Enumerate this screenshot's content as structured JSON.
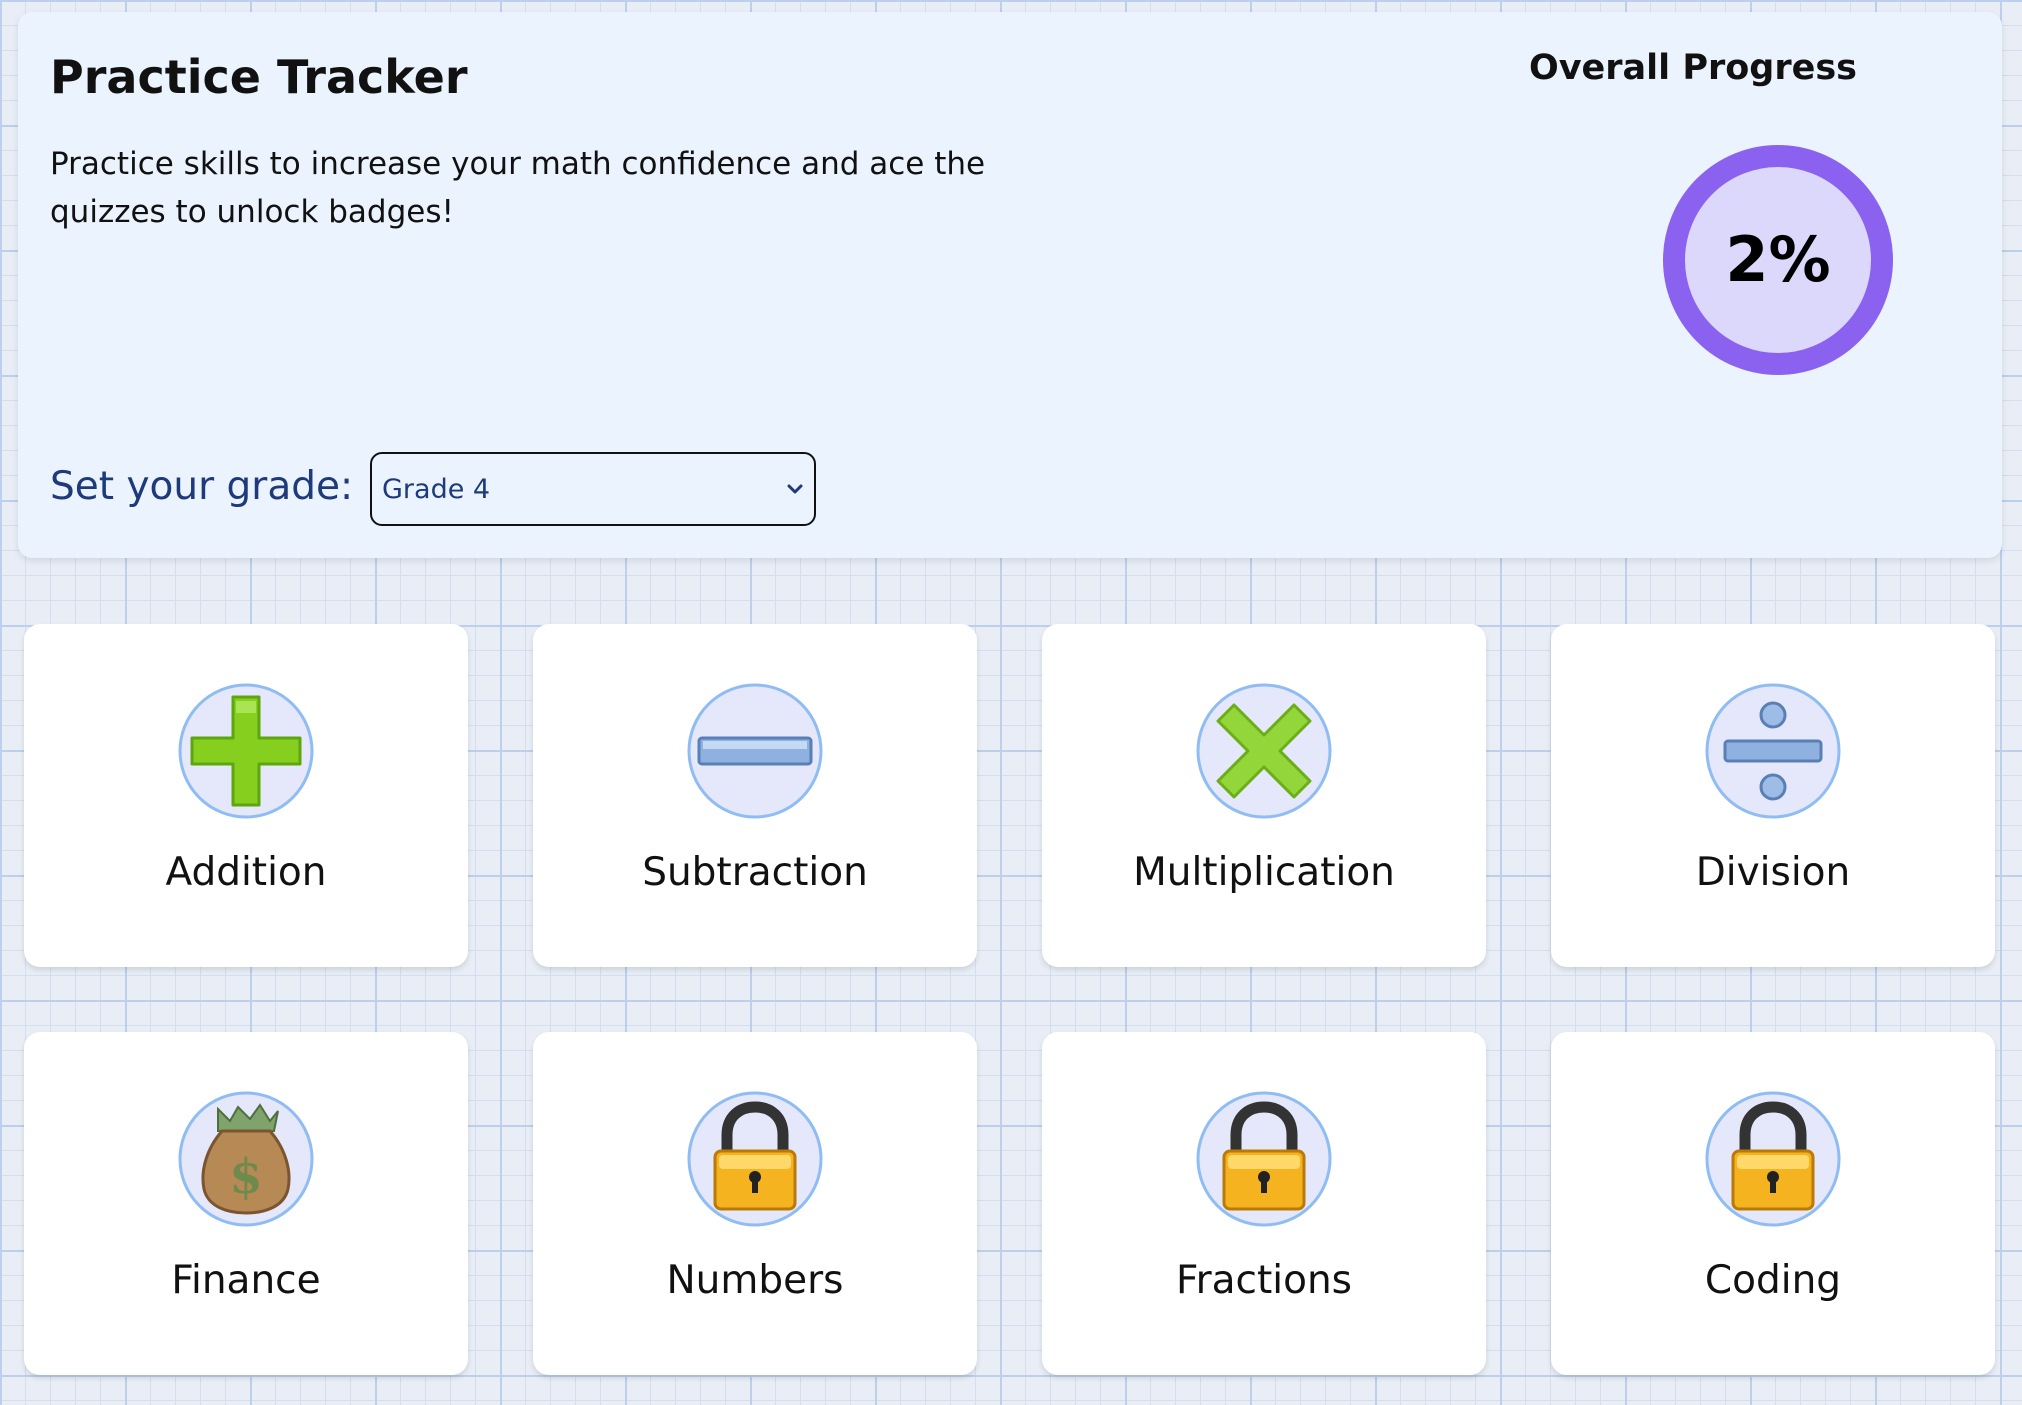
{
  "header": {
    "title": "Practice Tracker",
    "intro": "Practice skills to increase your math confidence and ace the quizzes to unlock badges!",
    "grade_label": "Set your grade:",
    "grade_selected": "Grade 4"
  },
  "progress": {
    "heading": "Overall Progress",
    "label": "2%",
    "fraction": 0.02,
    "ring_color": "#8b62f0",
    "fill_color": "#dcd8fc"
  },
  "skills": [
    {
      "label": "Addition",
      "icon": "plus-icon",
      "locked": false
    },
    {
      "label": "Subtraction",
      "icon": "minus-icon",
      "locked": false
    },
    {
      "label": "Multiplication",
      "icon": "times-icon",
      "locked": false
    },
    {
      "label": "Division",
      "icon": "divide-icon",
      "locked": false
    },
    {
      "label": "Finance",
      "icon": "money-bag-icon",
      "locked": false
    },
    {
      "label": "Numbers",
      "icon": "lock-icon",
      "locked": true
    },
    {
      "label": "Fractions",
      "icon": "lock-icon",
      "locked": true
    },
    {
      "label": "Coding",
      "icon": "lock-icon",
      "locked": true
    }
  ],
  "colors": {
    "icon_circle_fill": "#e5e7fb",
    "icon_circle_border": "#8fbdf3",
    "green": "#86cf1f",
    "label_blue": "#1e3a7a"
  }
}
